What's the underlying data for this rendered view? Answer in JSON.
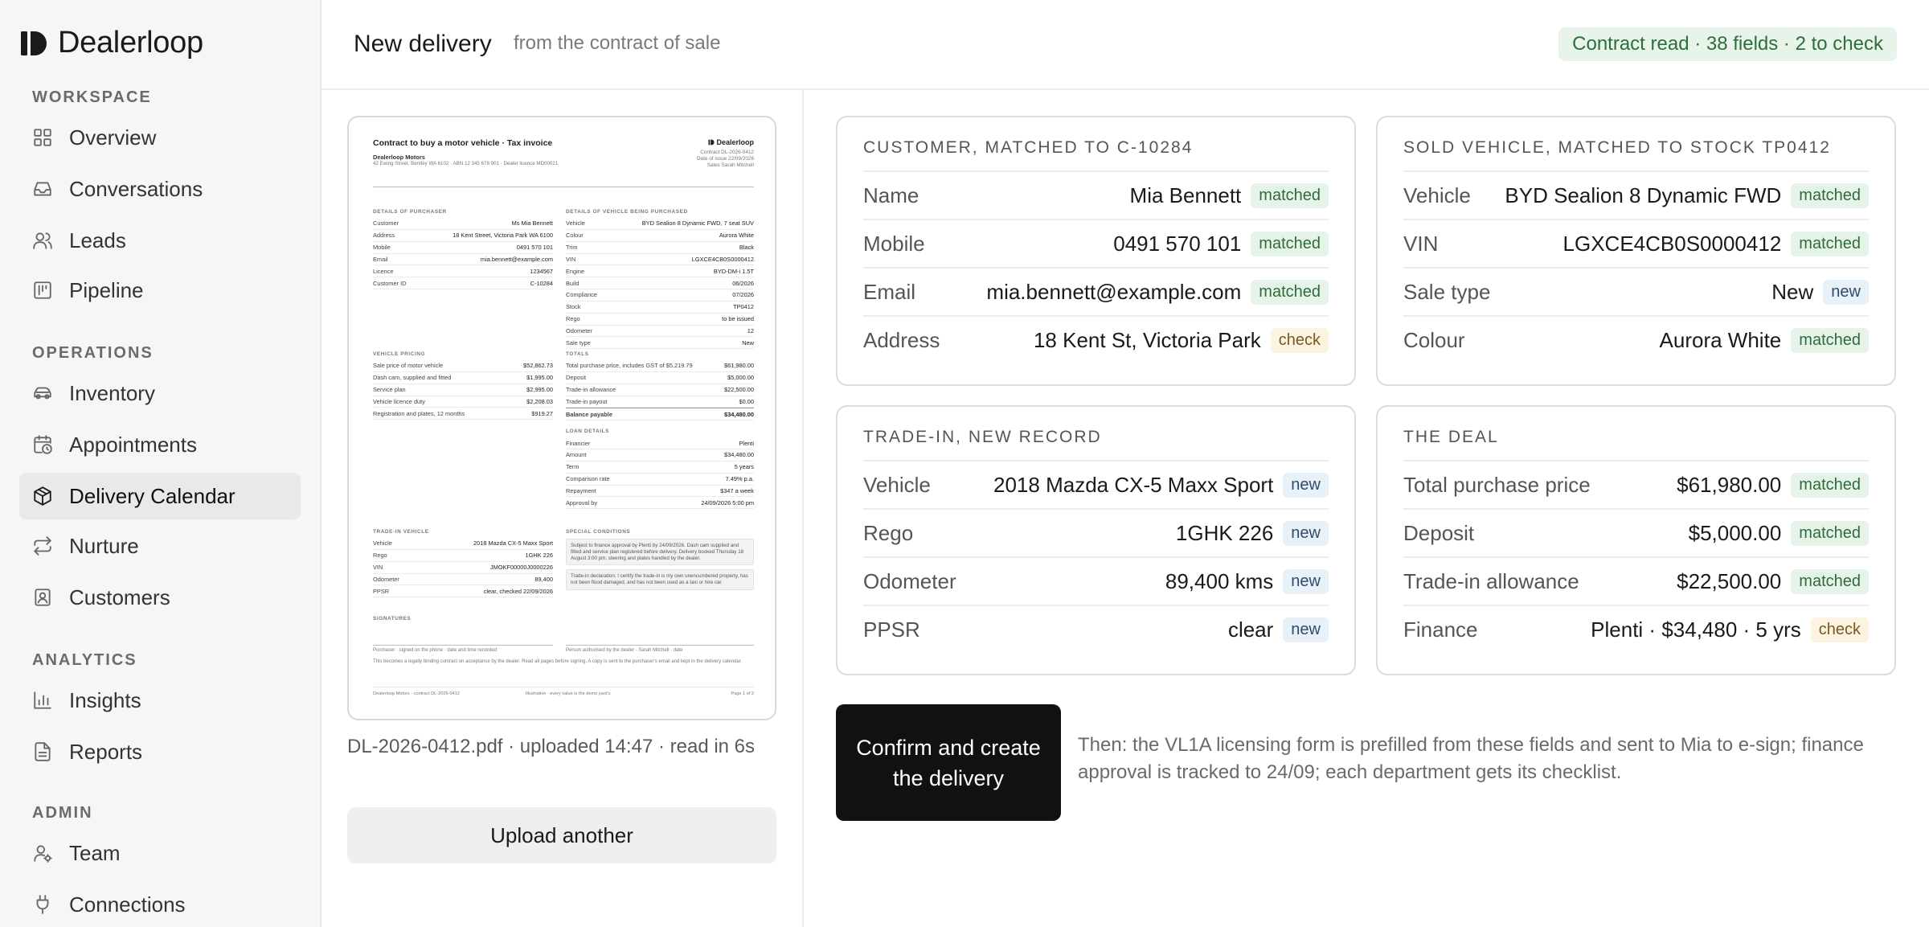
{
  "app": {
    "name": "Dealerloop"
  },
  "sidebar": {
    "sections": [
      {
        "label": "WORKSPACE",
        "items": [
          {
            "label": "Overview",
            "icon": "grid-icon"
          },
          {
            "label": "Conversations",
            "icon": "inbox-icon"
          },
          {
            "label": "Leads",
            "icon": "users-icon"
          },
          {
            "label": "Pipeline",
            "icon": "pipeline-icon"
          }
        ]
      },
      {
        "label": "OPERATIONS",
        "items": [
          {
            "label": "Inventory",
            "icon": "car-icon"
          },
          {
            "label": "Appointments",
            "icon": "calendar-clock-icon"
          },
          {
            "label": "Delivery Calendar",
            "icon": "package-icon",
            "active": true
          },
          {
            "label": "Nurture",
            "icon": "repeat-icon"
          },
          {
            "label": "Customers",
            "icon": "contact-icon"
          }
        ]
      },
      {
        "label": "ANALYTICS",
        "items": [
          {
            "label": "Insights",
            "icon": "bar-chart-icon"
          },
          {
            "label": "Reports",
            "icon": "file-text-icon"
          }
        ]
      },
      {
        "label": "ADMIN",
        "items": [
          {
            "label": "Team",
            "icon": "team-icon"
          },
          {
            "label": "Connections",
            "icon": "plug-icon"
          }
        ]
      }
    ]
  },
  "header": {
    "title": "New delivery",
    "subtitle": "from the contract of sale",
    "status": "Contract read · 38 fields · 2 to check"
  },
  "document": {
    "title": "Contract to buy a motor vehicle · Tax invoice",
    "brand": "Dealerloop",
    "dealer": "Dealerloop Motors",
    "dealer_address": "42 Ewing Street, Bentley WA 6102 · ABN 12 345 678 901 · Dealer licence MD00021",
    "contract_no": "Contract DL-2026-0412",
    "issue_date": "Date of issue 22/09/2026",
    "salesperson": "Sales Sarah Mitchell",
    "purchaser_heading": "Details of purchaser",
    "purchaser": [
      [
        "Customer",
        "Ms Mia Bennett"
      ],
      [
        "Address",
        "18 Kent Street, Victoria Park WA 6100"
      ],
      [
        "Mobile",
        "0491 570 101"
      ],
      [
        "Email",
        "mia.bennett@example.com"
      ],
      [
        "Licence",
        "1234567"
      ],
      [
        "Customer ID",
        "C-10284"
      ]
    ],
    "vehicle_heading": "Details of vehicle being purchased",
    "vehicle": [
      [
        "Vehicle",
        "BYD Sealion 8 Dynamic FWD, 7 seat SUV"
      ],
      [
        "Colour",
        "Aurora White"
      ],
      [
        "Trim",
        "Black"
      ],
      [
        "VIN",
        "LGXCE4CB0S0000412"
      ],
      [
        "Engine",
        "BYD-DM-i 1.5T"
      ],
      [
        "Build",
        "06/2026"
      ],
      [
        "Compliance",
        "07/2026"
      ],
      [
        "Stock",
        "TP0412"
      ],
      [
        "Rego",
        "to be issued"
      ],
      [
        "Odometer",
        "12"
      ],
      [
        "Sale type",
        "New"
      ]
    ],
    "pricing_heading": "Vehicle pricing",
    "pricing": [
      [
        "Sale price of motor vehicle",
        "$52,862.73"
      ],
      [
        "Dash cam, supplied and fitted",
        "$1,995.00"
      ],
      [
        "Service plan",
        "$2,995.00"
      ],
      [
        "Vehicle licence duty",
        "$2,208.03"
      ],
      [
        "Registration and plates, 12 months",
        "$919.27"
      ]
    ],
    "totals_heading": "Totals",
    "totals": [
      [
        "Total purchase price, includes GST of $5,219.79",
        "$61,980.00"
      ],
      [
        "Deposit",
        "$5,000.00"
      ],
      [
        "Trade-in allowance",
        "$22,500.00"
      ],
      [
        "Trade-in payout",
        "$0.00"
      ],
      [
        "Balance payable",
        "$34,480.00"
      ]
    ],
    "loan_heading": "Loan details",
    "loan": [
      [
        "Financier",
        "Plenti"
      ],
      [
        "Amount",
        "$34,480.00"
      ],
      [
        "Term",
        "5 years"
      ],
      [
        "Comparison rate",
        "7.49% p.a."
      ],
      [
        "Repayment",
        "$347 a week"
      ],
      [
        "Approval by",
        "24/09/2026 5:00 pm"
      ]
    ],
    "trade_heading": "Trade-in vehicle",
    "trade": [
      [
        "Vehicle",
        "2018 Mazda CX-5 Maxx Sport"
      ],
      [
        "Rego",
        "1GHK 226"
      ],
      [
        "VIN",
        "JMOKF00000J0000226"
      ],
      [
        "Odometer",
        "89,400"
      ],
      [
        "PPSR",
        "clear, checked 22/09/2026"
      ]
    ],
    "special_heading": "Special conditions",
    "special_1": "Subject to finance approval by Plenti by 24/09/2026. Dash cam supplied and fitted and service plan registered before delivery. Delivery booked Thursday 18 August 3:00 pm; steering and plates handled by the dealer.",
    "special_2": "Trade-in declaration: I certify the trade-in is my own unencumbered property, has not been flood damaged, and has not been used as a taxi or hire car.",
    "signatures_heading": "Signatures",
    "sig_purchaser": "Purchaser · signed on the phone · date and time recorded",
    "sig_dealer": "Person authorised by the dealer · Sarah Mitchell · date",
    "disclaimer": "This becomes a legally binding contract on acceptance by the dealer. Read all pages before signing. A copy is sent to the purchaser's email and kept in the delivery calendar.",
    "footer_left": "Dealerloop Motors · contract DL-2026-0412",
    "footer_mid": "Illustrative · every value is the demo yard's",
    "footer_right": "Page 1 of 2"
  },
  "file": {
    "caption": "DL-2026-0412.pdf · uploaded 14:47 · read in 6s",
    "upload_label": "Upload another"
  },
  "cards": {
    "customer": {
      "title": "CUSTOMER, MATCHED TO C-10284",
      "rows": [
        {
          "label": "Name",
          "value": "Mia Bennett",
          "badge": "matched"
        },
        {
          "label": "Mobile",
          "value": "0491 570 101",
          "badge": "matched"
        },
        {
          "label": "Email",
          "value": "mia.bennett@example.com",
          "badge": "matched"
        },
        {
          "label": "Address",
          "value": "18 Kent St, Victoria Park",
          "badge": "check"
        }
      ]
    },
    "vehicle": {
      "title": "SOLD VEHICLE, MATCHED TO STOCK TP0412",
      "rows": [
        {
          "label": "Vehicle",
          "value": "BYD Sealion 8 Dynamic FWD",
          "badge": "matched"
        },
        {
          "label": "VIN",
          "value": "LGXCE4CB0S0000412",
          "badge": "matched"
        },
        {
          "label": "Sale type",
          "value": "New",
          "badge": "new"
        },
        {
          "label": "Colour",
          "value": "Aurora White",
          "badge": "matched"
        }
      ]
    },
    "trade": {
      "title": "TRADE-IN, NEW RECORD",
      "rows": [
        {
          "label": "Vehicle",
          "value": "2018 Mazda CX-5 Maxx Sport",
          "badge": "new"
        },
        {
          "label": "Rego",
          "value": "1GHK 226",
          "badge": "new"
        },
        {
          "label": "Odometer",
          "value": "89,400 kms",
          "badge": "new"
        },
        {
          "label": "PPSR",
          "value": "clear",
          "badge": "new"
        }
      ]
    },
    "deal": {
      "title": "THE DEAL",
      "rows": [
        {
          "label": "Total purchase price",
          "value": "$61,980.00",
          "badge": "matched"
        },
        {
          "label": "Deposit",
          "value": "$5,000.00",
          "badge": "matched"
        },
        {
          "label": "Trade-in allowance",
          "value": "$22,500.00",
          "badge": "matched"
        },
        {
          "label": "Finance",
          "value": "Plenti · $34,480 · 5 yrs",
          "badge": "check"
        }
      ]
    }
  },
  "actions": {
    "confirm_label": "Confirm and create the delivery",
    "then_text": "Then: the VL1A licensing form is prefilled from these fields and sent to Mia to e-sign; finance approval is tracked to 24/09; each department gets its checklist."
  },
  "colors": {
    "matched_bg": "#e6f3e8",
    "matched_fg": "#2f6b3b",
    "check_bg": "#fdf3e1",
    "check_fg": "#7a5a1d",
    "new_bg": "#e8f0f8",
    "new_fg": "#2e4c6b",
    "primary": "#111111"
  }
}
